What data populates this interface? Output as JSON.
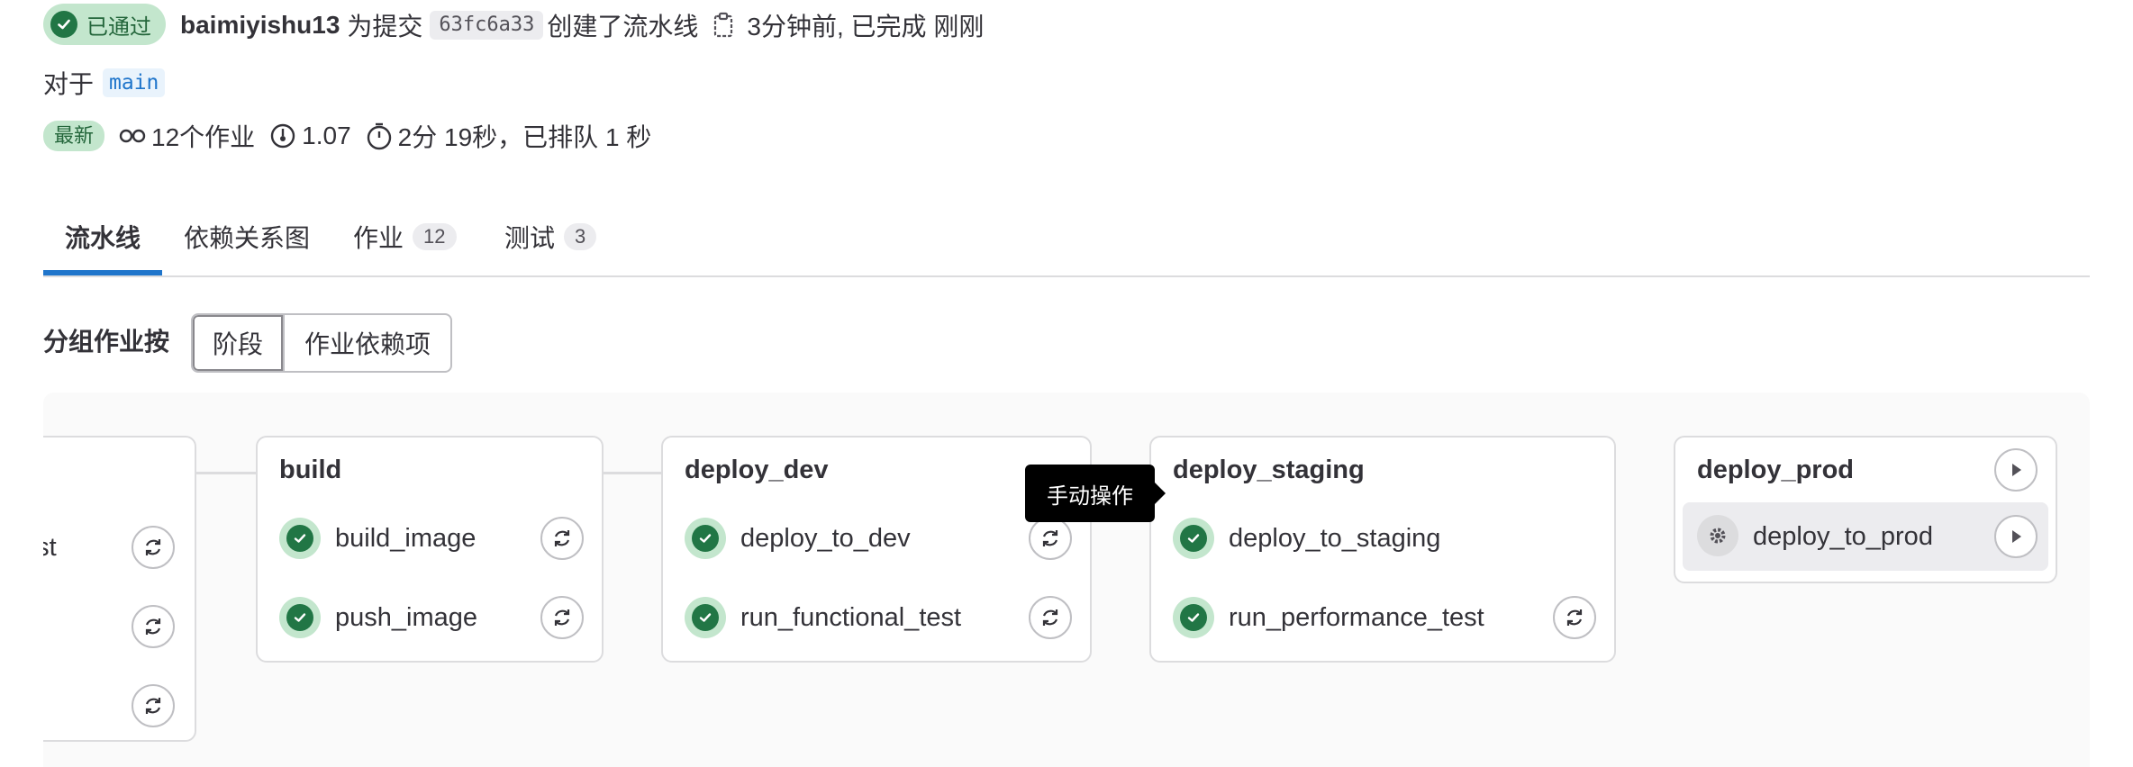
{
  "header": {
    "status_label": "已通过",
    "user": "baimiyishu13",
    "for_commit_text": "为提交",
    "commit_sha": "63fc6a33",
    "created_text": "创建了流水线",
    "time_text": "3分钟前, 已完成 刚刚",
    "for_text": "对于",
    "ref": "main",
    "latest_badge": "最新",
    "jobs_count": "12个作业",
    "version": "1.07",
    "duration": "2分 19秒，已排队 1 秒"
  },
  "tabs": [
    {
      "label": "流水线"
    },
    {
      "label": "依赖关系图"
    },
    {
      "label": "作业",
      "count": "12"
    },
    {
      "label": "测试",
      "count": "3"
    }
  ],
  "group_by": {
    "label": "分组作业按",
    "options": [
      "阶段",
      "作业依赖项"
    ],
    "selected": "阶段"
  },
  "stages": [
    {
      "name": "",
      "jobs": [
        {
          "name": "ast"
        },
        {
          "name": ""
        },
        {
          "name": ""
        }
      ]
    },
    {
      "name": "build",
      "jobs": [
        {
          "name": "build_image"
        },
        {
          "name": "push_image"
        }
      ]
    },
    {
      "name": "deploy_dev",
      "jobs": [
        {
          "name": "deploy_to_dev"
        },
        {
          "name": "run_functional_test"
        }
      ]
    },
    {
      "name": "deploy_staging",
      "jobs": [
        {
          "name": "deploy_to_staging"
        },
        {
          "name": "run_performance_test"
        }
      ]
    },
    {
      "name": "deploy_prod",
      "jobs": [
        {
          "name": "deploy_to_prod"
        }
      ]
    }
  ],
  "tooltip": "手动操作",
  "colors": {
    "success": "#217645",
    "success_bg": "#c3e6cd",
    "link": "#1f75cb",
    "tab_active": "#1f75cb"
  }
}
